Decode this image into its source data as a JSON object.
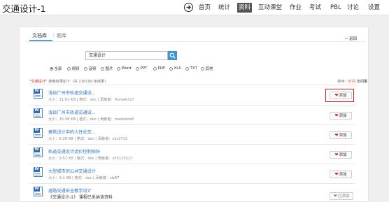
{
  "header": {
    "course_title": "交通设计-1",
    "nav": [
      {
        "label": "首页"
      },
      {
        "label": "统计"
      },
      {
        "label": "资料"
      },
      {
        "label": "互动课堂"
      },
      {
        "label": "作业"
      },
      {
        "label": "考试"
      },
      {
        "label": "PBL"
      },
      {
        "label": "讨论"
      },
      {
        "label": "设置"
      }
    ]
  },
  "tabs": [
    {
      "label": "文档库"
    },
    {
      "label": "题库"
    }
  ],
  "tab_separator": "|",
  "back_link": {
    "label": "返回"
  },
  "search": {
    "value": "交通设计"
  },
  "filters": [
    {
      "label": "全部",
      "selected": true
    },
    {
      "label": "视频",
      "selected": false
    },
    {
      "label": "音频",
      "selected": false
    },
    {
      "label": "图片",
      "selected": false
    },
    {
      "label": "Word",
      "selected": false
    },
    {
      "label": "PPT",
      "selected": false
    },
    {
      "label": "PDF",
      "selected": false
    },
    {
      "label": "XLS",
      "selected": false
    },
    {
      "label": "TXT",
      "selected": false
    },
    {
      "label": "其他",
      "selected": false
    }
  ],
  "result_summary": {
    "query": "\"交通设计\"",
    "text": " 搜索结果如下（共 218199 条结果）"
  },
  "sort": {
    "label": "排序：",
    "hot": "时间",
    "visits": "访问量"
  },
  "documents": [
    {
      "title": "浅谈广州市轨道交通设...",
      "meta": "大小：21.61 KB | 格式：doc | 贡献者：Homek317",
      "action": "添加"
    },
    {
      "title": "浅谈广州市轨道交通设...",
      "meta": "大小：15.36 KB | 格式：doc | 贡献者：madeline8",
      "action": "添加"
    },
    {
      "title": "建筑设计中的人性化交...",
      "meta": "大小：8.29 KB | 格式：doc | 贡献者：xzc2712",
      "action": "添加"
    },
    {
      "title": "轨道交通设计造价控制探析",
      "meta": "大小：9.51 KB | 格式：doc | 贡献者：z35125217",
      "action": "添加"
    },
    {
      "title": "大型城市的公共交通设计",
      "meta": "大小：9.1 KB | 格式：doc | 贡献者：slz67",
      "action": "添加"
    },
    {
      "title": "道路交通安全教学设计",
      "meta": "",
      "action": "已添加"
    }
  ],
  "tooltip": "《交通设计-1》 课程已采纳该资料"
}
